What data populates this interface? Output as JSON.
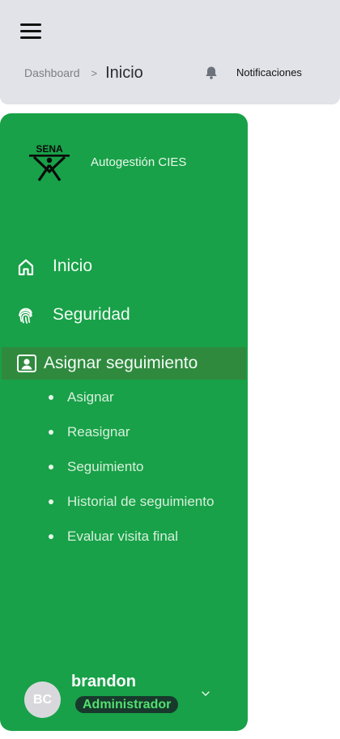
{
  "header": {
    "menu_icon": "hamburger-icon",
    "breadcrumb": {
      "parent": "Dashboard",
      "separator": ">",
      "current": "Inicio"
    },
    "notifications": {
      "icon": "bell-icon",
      "label": "Notificaciones"
    }
  },
  "sidebar": {
    "background": "#18a148",
    "active_background": "#2f8a3e",
    "logo_text": "SENA",
    "brand": "Autogestión CIES",
    "items": [
      {
        "label": "Inicio",
        "icon": "home-icon"
      },
      {
        "label": "Seguridad",
        "icon": "fingerprint-icon"
      },
      {
        "label": "Asignar seguimiento",
        "icon": "contact-card-icon",
        "active": true
      }
    ],
    "subitems": [
      {
        "label": "Asignar"
      },
      {
        "label": "Reasignar"
      },
      {
        "label": "Seguimiento"
      },
      {
        "label": "Historial de seguimiento"
      },
      {
        "label": "Evaluar visita final"
      }
    ],
    "user": {
      "initials": "BC",
      "name": "brandon",
      "role": "Administrador",
      "role_color": "#52e06f",
      "menu_icon": "chevron-down-icon"
    }
  }
}
